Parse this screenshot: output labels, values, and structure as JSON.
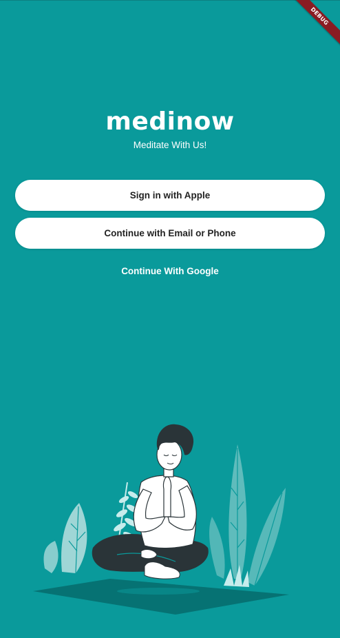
{
  "app": {
    "logo_text": "medinow",
    "tagline": "Meditate With Us!"
  },
  "debug_banner": {
    "label": "DEBUG"
  },
  "auth": {
    "apple_label": "Sign in with Apple",
    "email_label": "Continue with Email or Phone",
    "google_label": "Continue With Google"
  },
  "colors": {
    "background": "#0a9a9b",
    "button_bg": "#ffffff",
    "button_text": "#222222",
    "debug_ribbon": "#8a1b22"
  }
}
